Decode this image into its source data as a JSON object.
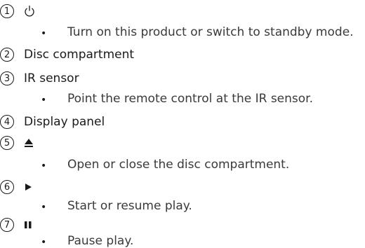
{
  "items": [
    {
      "number": "1",
      "icon": "power-icon",
      "description": "Turn on this product or switch to standby mode."
    },
    {
      "number": "2",
      "title": "Disc compartment"
    },
    {
      "number": "3",
      "title": "IR sensor",
      "description": "Point the remote control at the IR sensor."
    },
    {
      "number": "4",
      "title": "Display panel"
    },
    {
      "number": "5",
      "icon": "eject-icon",
      "description": "Open or close the disc compartment."
    },
    {
      "number": "6",
      "icon": "play-icon",
      "description": "Start or resume play."
    },
    {
      "number": "7",
      "icon": "pause-icon",
      "description": "Pause play."
    }
  ],
  "bullet_char": "•"
}
